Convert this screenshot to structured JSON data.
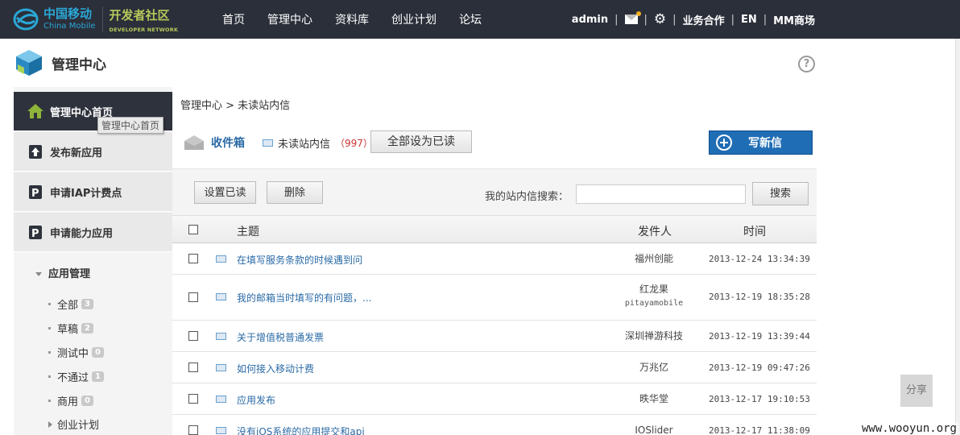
{
  "header": {
    "logo_cn": "中国移动",
    "logo_en": "China Mobile",
    "dev_cn": "开发者社区",
    "dev_en": "DEVELOPER NETWORK",
    "nav": [
      "首页",
      "管理中心",
      "资料库",
      "创业计划",
      "论坛"
    ],
    "user": "admin",
    "links": [
      "业务合作",
      "EN",
      "MM商场"
    ]
  },
  "page": {
    "title": "管理中心",
    "help": "?"
  },
  "sidebar": {
    "items": [
      "管理中心首页",
      "发布新应用",
      "申请IAP计费点",
      "申请能力应用"
    ],
    "tooltip": "管理中心首页",
    "section": "应用管理",
    "sub_items": [
      {
        "label": "全部",
        "count": "3"
      },
      {
        "label": "草稿",
        "count": "2"
      },
      {
        "label": "测试中",
        "count": "0"
      },
      {
        "label": "不通过",
        "count": "1"
      },
      {
        "label": "商用",
        "count": "0"
      }
    ],
    "extra": "创业计划"
  },
  "content": {
    "breadcrumb": "管理中心 > 未读站内信",
    "inbox_title": "收件箱",
    "unread_label": "未读站内信",
    "unread_count": "（997）",
    "mark_all_read": "全部设为已读",
    "write_new": "写新信",
    "set_read": "设置已读",
    "delete": "删除",
    "search_label": "我的站内信搜索：",
    "search_btn": "搜索",
    "columns": {
      "subject": "主题",
      "sender": "发件人",
      "time": "时间"
    },
    "rows": [
      {
        "subject": "在填写服务条款的时候遇到问",
        "sender": "福州创能",
        "sender2": "",
        "time": "2013-12-24 13:34:39"
      },
      {
        "subject": "我的邮箱当时填写的有问题，...",
        "sender": "红龙果",
        "sender2": "pitayamobile",
        "time": "2013-12-19 18:35:28"
      },
      {
        "subject": "关于增值税普通发票",
        "sender": "深圳禅游科技",
        "sender2": "",
        "time": "2013-12-19 13:39:44"
      },
      {
        "subject": "如何接入移动计费",
        "sender": "万兆亿",
        "sender2": "",
        "time": "2013-12-19 09:47:26"
      },
      {
        "subject": "应用发布",
        "sender": "昳华堂",
        "sender2": "",
        "time": "2013-12-17 19:10:53"
      },
      {
        "subject": "没有iOS系统的应用提交和api",
        "sender": "IOSlider",
        "sender2": "",
        "time": "2013-12-17 11:38:09"
      }
    ]
  },
  "share": "分享",
  "watermark": "www.wooyun.org"
}
